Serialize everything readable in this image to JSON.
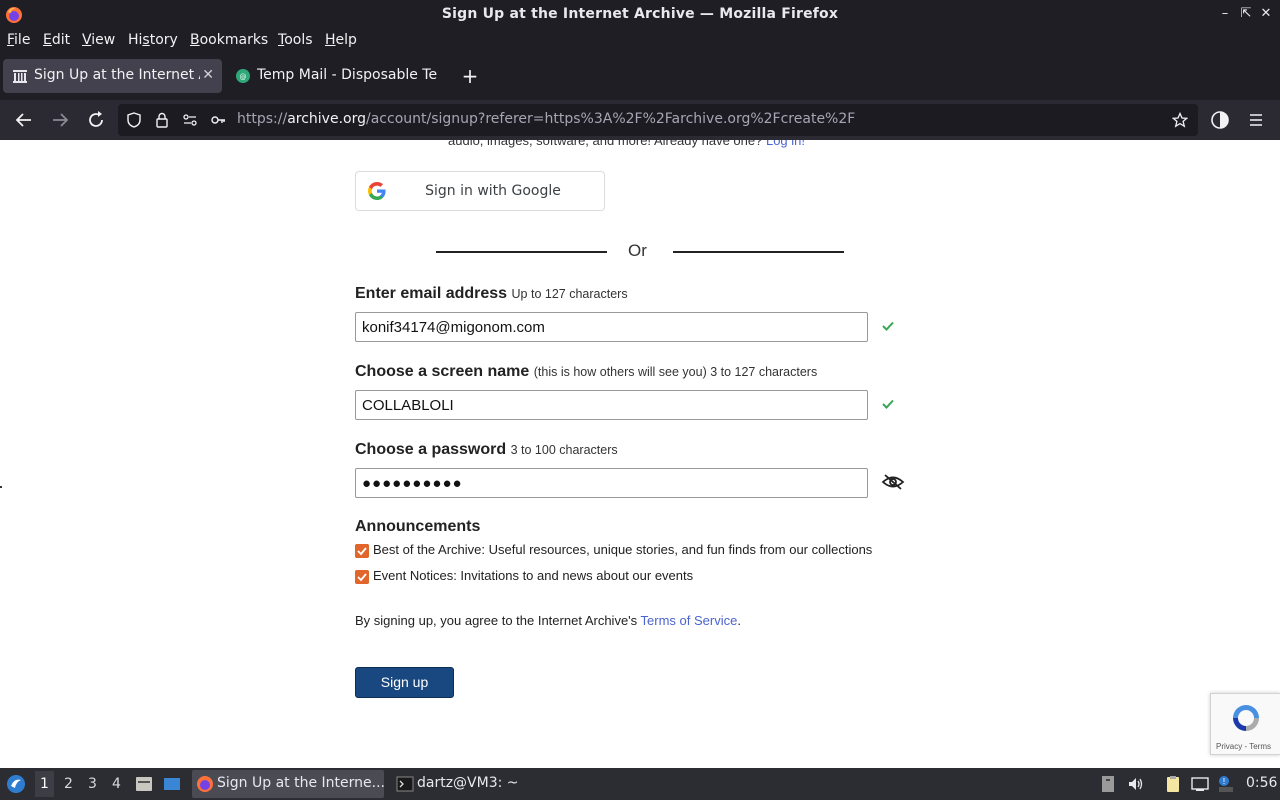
{
  "window": {
    "title": "Sign Up at the Internet Archive — Mozilla Firefox"
  },
  "menubar": {
    "items": [
      {
        "label": "File",
        "mnemonic": "F"
      },
      {
        "label": "Edit",
        "mnemonic": "E"
      },
      {
        "label": "View",
        "mnemonic": "V"
      },
      {
        "label": "History",
        "mnemonic": "s"
      },
      {
        "label": "Bookmarks",
        "mnemonic": "B"
      },
      {
        "label": "Tools",
        "mnemonic": "T"
      },
      {
        "label": "Help",
        "mnemonic": "H"
      }
    ]
  },
  "tabs": [
    {
      "label": "Sign Up at the Internet Archive",
      "active": true,
      "icon": "archive-icon"
    },
    {
      "label": "Temp Mail - Disposable Temporary Email",
      "active": false,
      "icon": "tempmail-icon"
    }
  ],
  "urlbar": {
    "scheme": "https://",
    "host": "archive.org",
    "path": "/account/signup?referer=https%3A%2F%2Farchive.org%2Fcreate%2F"
  },
  "page": {
    "intro_text": "audio, images, software, and more! Already have one? ",
    "login_link": "Log in!",
    "google_button": "Sign in with Google",
    "or_text": "Or",
    "email": {
      "label": "Enter email address",
      "hint": "Up to 127 characters",
      "value": "konif34174@migonom.com"
    },
    "screen_name": {
      "label": "Choose a screen name",
      "hint": "(this is how others will see you) 3 to 127 characters",
      "value": "COLLABLOLI"
    },
    "password": {
      "label": "Choose a password",
      "hint": "3 to 100 characters",
      "masked_value": "●●●●●●●●●●"
    },
    "announcements": {
      "title": "Announcements",
      "options": [
        {
          "label": "Best of the Archive: Useful resources, unique stories, and fun finds from our collections",
          "checked": true
        },
        {
          "label": "Event Notices: Invitations to and news about our events",
          "checked": true
        }
      ]
    },
    "tos_prefix": "By signing up, you agree to the Internet Archive's ",
    "tos_link": "Terms of Service",
    "tos_suffix": ".",
    "signup_button": "Sign up",
    "recaptcha": {
      "privacy": "Privacy",
      "sep": " - ",
      "terms": "Terms"
    }
  },
  "taskbar": {
    "workspaces": [
      "1",
      "2",
      "3",
      "4"
    ],
    "current_workspace": "1",
    "tasks": [
      {
        "label": "Sign Up at the Interne...",
        "active": true
      },
      {
        "label": "dartz@VM3: ~",
        "active": false
      }
    ],
    "clock": "0:56"
  },
  "colors": {
    "accent_checkbox": "#e0662c",
    "signup_button": "#194880",
    "link": "#4b64d0",
    "valid_check": "#3aa655"
  }
}
